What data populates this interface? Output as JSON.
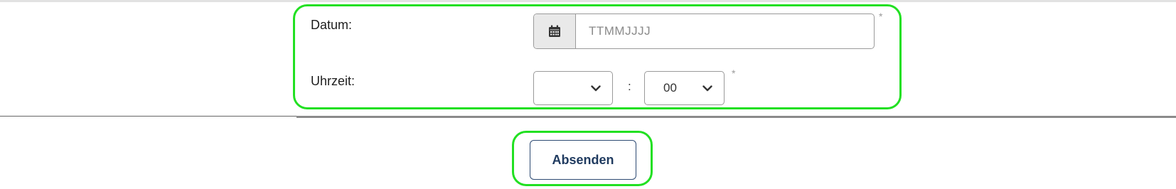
{
  "form": {
    "date": {
      "label": "Datum:",
      "placeholder": "TTMMJJJJ",
      "value": "",
      "addon_icon": "calendar-icon",
      "required_marker": "*"
    },
    "time": {
      "label": "Uhrzeit:",
      "hour_value": "",
      "separator": ":",
      "minute_value": "00",
      "required_marker": "*",
      "dropdown_icon": "chevron-down-icon"
    }
  },
  "actions": {
    "submit_label": "Absenden"
  },
  "colors": {
    "highlight": "#22e022",
    "button_text": "#1f3a5f",
    "border": "#9a9a9a",
    "addon_background": "#e9e9e9"
  }
}
